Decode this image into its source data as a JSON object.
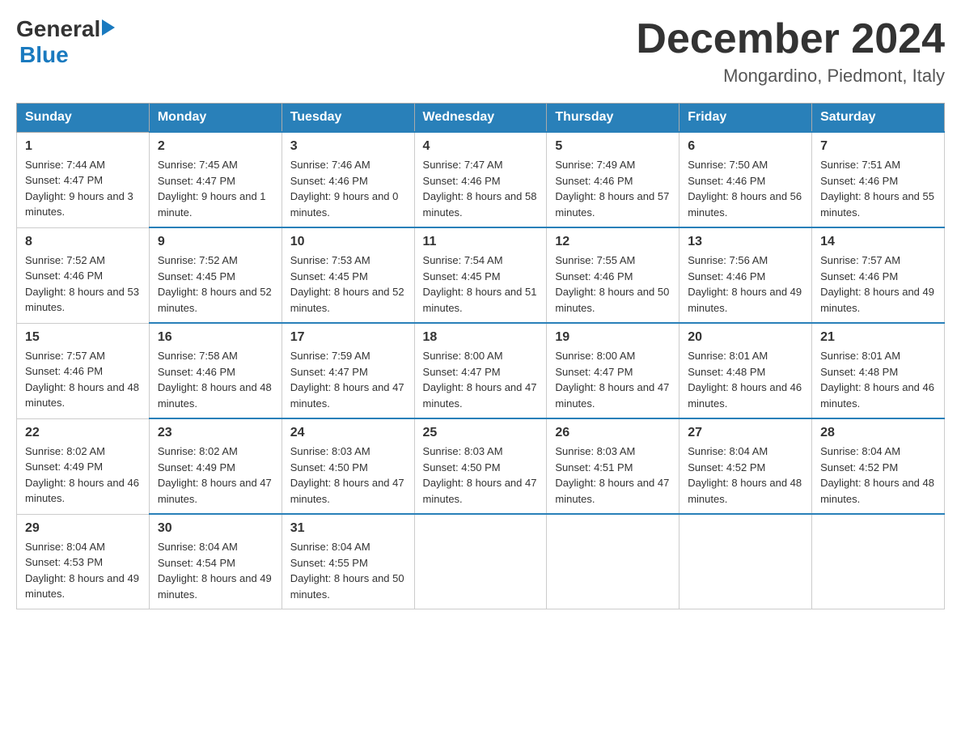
{
  "header": {
    "logo_general": "General",
    "logo_blue": "Blue",
    "month_year": "December 2024",
    "location": "Mongardino, Piedmont, Italy"
  },
  "columns": [
    "Sunday",
    "Monday",
    "Tuesday",
    "Wednesday",
    "Thursday",
    "Friday",
    "Saturday"
  ],
  "weeks": [
    [
      {
        "day": "1",
        "sunrise": "7:44 AM",
        "sunset": "4:47 PM",
        "daylight": "9 hours and 3 minutes."
      },
      {
        "day": "2",
        "sunrise": "7:45 AM",
        "sunset": "4:47 PM",
        "daylight": "9 hours and 1 minute."
      },
      {
        "day": "3",
        "sunrise": "7:46 AM",
        "sunset": "4:46 PM",
        "daylight": "9 hours and 0 minutes."
      },
      {
        "day": "4",
        "sunrise": "7:47 AM",
        "sunset": "4:46 PM",
        "daylight": "8 hours and 58 minutes."
      },
      {
        "day": "5",
        "sunrise": "7:49 AM",
        "sunset": "4:46 PM",
        "daylight": "8 hours and 57 minutes."
      },
      {
        "day": "6",
        "sunrise": "7:50 AM",
        "sunset": "4:46 PM",
        "daylight": "8 hours and 56 minutes."
      },
      {
        "day": "7",
        "sunrise": "7:51 AM",
        "sunset": "4:46 PM",
        "daylight": "8 hours and 55 minutes."
      }
    ],
    [
      {
        "day": "8",
        "sunrise": "7:52 AM",
        "sunset": "4:46 PM",
        "daylight": "8 hours and 53 minutes."
      },
      {
        "day": "9",
        "sunrise": "7:52 AM",
        "sunset": "4:45 PM",
        "daylight": "8 hours and 52 minutes."
      },
      {
        "day": "10",
        "sunrise": "7:53 AM",
        "sunset": "4:45 PM",
        "daylight": "8 hours and 52 minutes."
      },
      {
        "day": "11",
        "sunrise": "7:54 AM",
        "sunset": "4:45 PM",
        "daylight": "8 hours and 51 minutes."
      },
      {
        "day": "12",
        "sunrise": "7:55 AM",
        "sunset": "4:46 PM",
        "daylight": "8 hours and 50 minutes."
      },
      {
        "day": "13",
        "sunrise": "7:56 AM",
        "sunset": "4:46 PM",
        "daylight": "8 hours and 49 minutes."
      },
      {
        "day": "14",
        "sunrise": "7:57 AM",
        "sunset": "4:46 PM",
        "daylight": "8 hours and 49 minutes."
      }
    ],
    [
      {
        "day": "15",
        "sunrise": "7:57 AM",
        "sunset": "4:46 PM",
        "daylight": "8 hours and 48 minutes."
      },
      {
        "day": "16",
        "sunrise": "7:58 AM",
        "sunset": "4:46 PM",
        "daylight": "8 hours and 48 minutes."
      },
      {
        "day": "17",
        "sunrise": "7:59 AM",
        "sunset": "4:47 PM",
        "daylight": "8 hours and 47 minutes."
      },
      {
        "day": "18",
        "sunrise": "8:00 AM",
        "sunset": "4:47 PM",
        "daylight": "8 hours and 47 minutes."
      },
      {
        "day": "19",
        "sunrise": "8:00 AM",
        "sunset": "4:47 PM",
        "daylight": "8 hours and 47 minutes."
      },
      {
        "day": "20",
        "sunrise": "8:01 AM",
        "sunset": "4:48 PM",
        "daylight": "8 hours and 46 minutes."
      },
      {
        "day": "21",
        "sunrise": "8:01 AM",
        "sunset": "4:48 PM",
        "daylight": "8 hours and 46 minutes."
      }
    ],
    [
      {
        "day": "22",
        "sunrise": "8:02 AM",
        "sunset": "4:49 PM",
        "daylight": "8 hours and 46 minutes."
      },
      {
        "day": "23",
        "sunrise": "8:02 AM",
        "sunset": "4:49 PM",
        "daylight": "8 hours and 47 minutes."
      },
      {
        "day": "24",
        "sunrise": "8:03 AM",
        "sunset": "4:50 PM",
        "daylight": "8 hours and 47 minutes."
      },
      {
        "day": "25",
        "sunrise": "8:03 AM",
        "sunset": "4:50 PM",
        "daylight": "8 hours and 47 minutes."
      },
      {
        "day": "26",
        "sunrise": "8:03 AM",
        "sunset": "4:51 PM",
        "daylight": "8 hours and 47 minutes."
      },
      {
        "day": "27",
        "sunrise": "8:04 AM",
        "sunset": "4:52 PM",
        "daylight": "8 hours and 48 minutes."
      },
      {
        "day": "28",
        "sunrise": "8:04 AM",
        "sunset": "4:52 PM",
        "daylight": "8 hours and 48 minutes."
      }
    ],
    [
      {
        "day": "29",
        "sunrise": "8:04 AM",
        "sunset": "4:53 PM",
        "daylight": "8 hours and 49 minutes."
      },
      {
        "day": "30",
        "sunrise": "8:04 AM",
        "sunset": "4:54 PM",
        "daylight": "8 hours and 49 minutes."
      },
      {
        "day": "31",
        "sunrise": "8:04 AM",
        "sunset": "4:55 PM",
        "daylight": "8 hours and 50 minutes."
      },
      null,
      null,
      null,
      null
    ]
  ]
}
